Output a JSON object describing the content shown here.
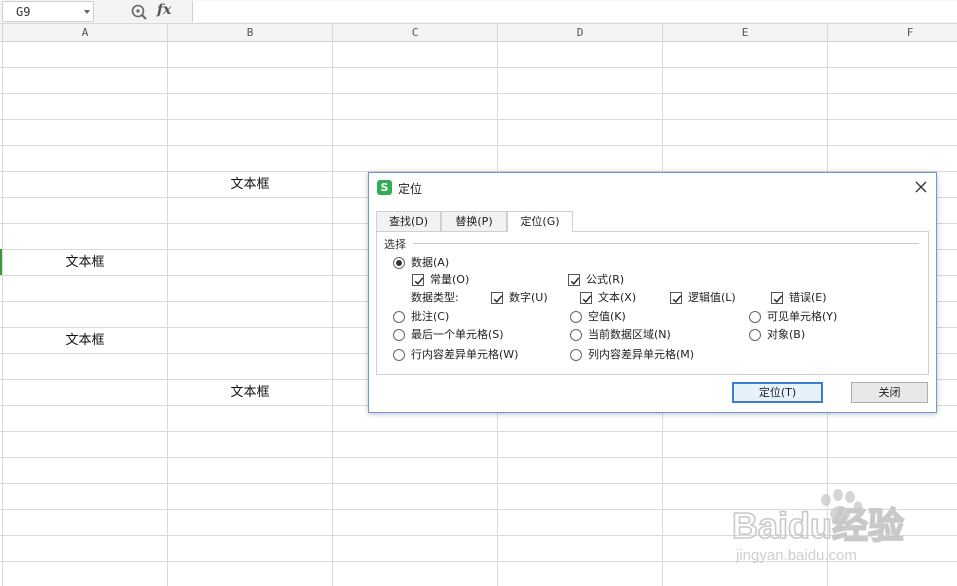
{
  "formula_bar": {
    "name_box": "G9",
    "zoom_icon": "zoom-icon",
    "fx_label": "fx",
    "formula_value": ""
  },
  "columns": [
    "A",
    "B",
    "C",
    "D",
    "E",
    "F"
  ],
  "cells": [
    {
      "ref": "B7",
      "text": "文本框"
    },
    {
      "ref": "A9",
      "text": "文本框"
    },
    {
      "ref": "A12",
      "text": "文本框"
    },
    {
      "ref": "B14",
      "text": "文本框"
    }
  ],
  "dialog": {
    "title": "定位",
    "logo_letter": "S",
    "tabs": [
      {
        "label": "查找(D)",
        "active": false
      },
      {
        "label": "替换(P)",
        "active": false
      },
      {
        "label": "定位(G)",
        "active": true
      }
    ],
    "group_label": "选择",
    "options": {
      "data": {
        "label": "数据(A)",
        "checked": true
      },
      "constant": {
        "label": "常量(O)",
        "checked": true
      },
      "formula": {
        "label": "公式(R)",
        "checked": true
      },
      "data_type_label": "数据类型:",
      "number": {
        "label": "数字(U)",
        "checked": true
      },
      "text": {
        "label": "文本(X)",
        "checked": true
      },
      "logical": {
        "label": "逻辑值(L)",
        "checked": true
      },
      "error": {
        "label": "错误(E)",
        "checked": true
      },
      "comment": {
        "label": "批注(C)",
        "checked": false
      },
      "blank": {
        "label": "空值(K)",
        "checked": false
      },
      "visible_cells": {
        "label": "可见单元格(Y)",
        "checked": false
      },
      "last_cell": {
        "label": "最后一个单元格(S)",
        "checked": false
      },
      "current_region": {
        "label": "当前数据区域(N)",
        "checked": false
      },
      "objects": {
        "label": "对象(B)",
        "checked": false
      },
      "row_diff": {
        "label": "行内容差异单元格(W)",
        "checked": false
      },
      "col_diff": {
        "label": "列内容差异单元格(M)",
        "checked": false
      }
    },
    "buttons": {
      "locate": "定位(T)",
      "close": "关闭"
    }
  },
  "watermark": {
    "brand": "Baidu经验",
    "url": "jingyan.baidu.com"
  },
  "colors": {
    "dialog_border": "#6d9ad4",
    "primary_button_border": "#3c7fd1",
    "logo_green": "#2fae55",
    "selection_marker": "#3c9a3c"
  }
}
